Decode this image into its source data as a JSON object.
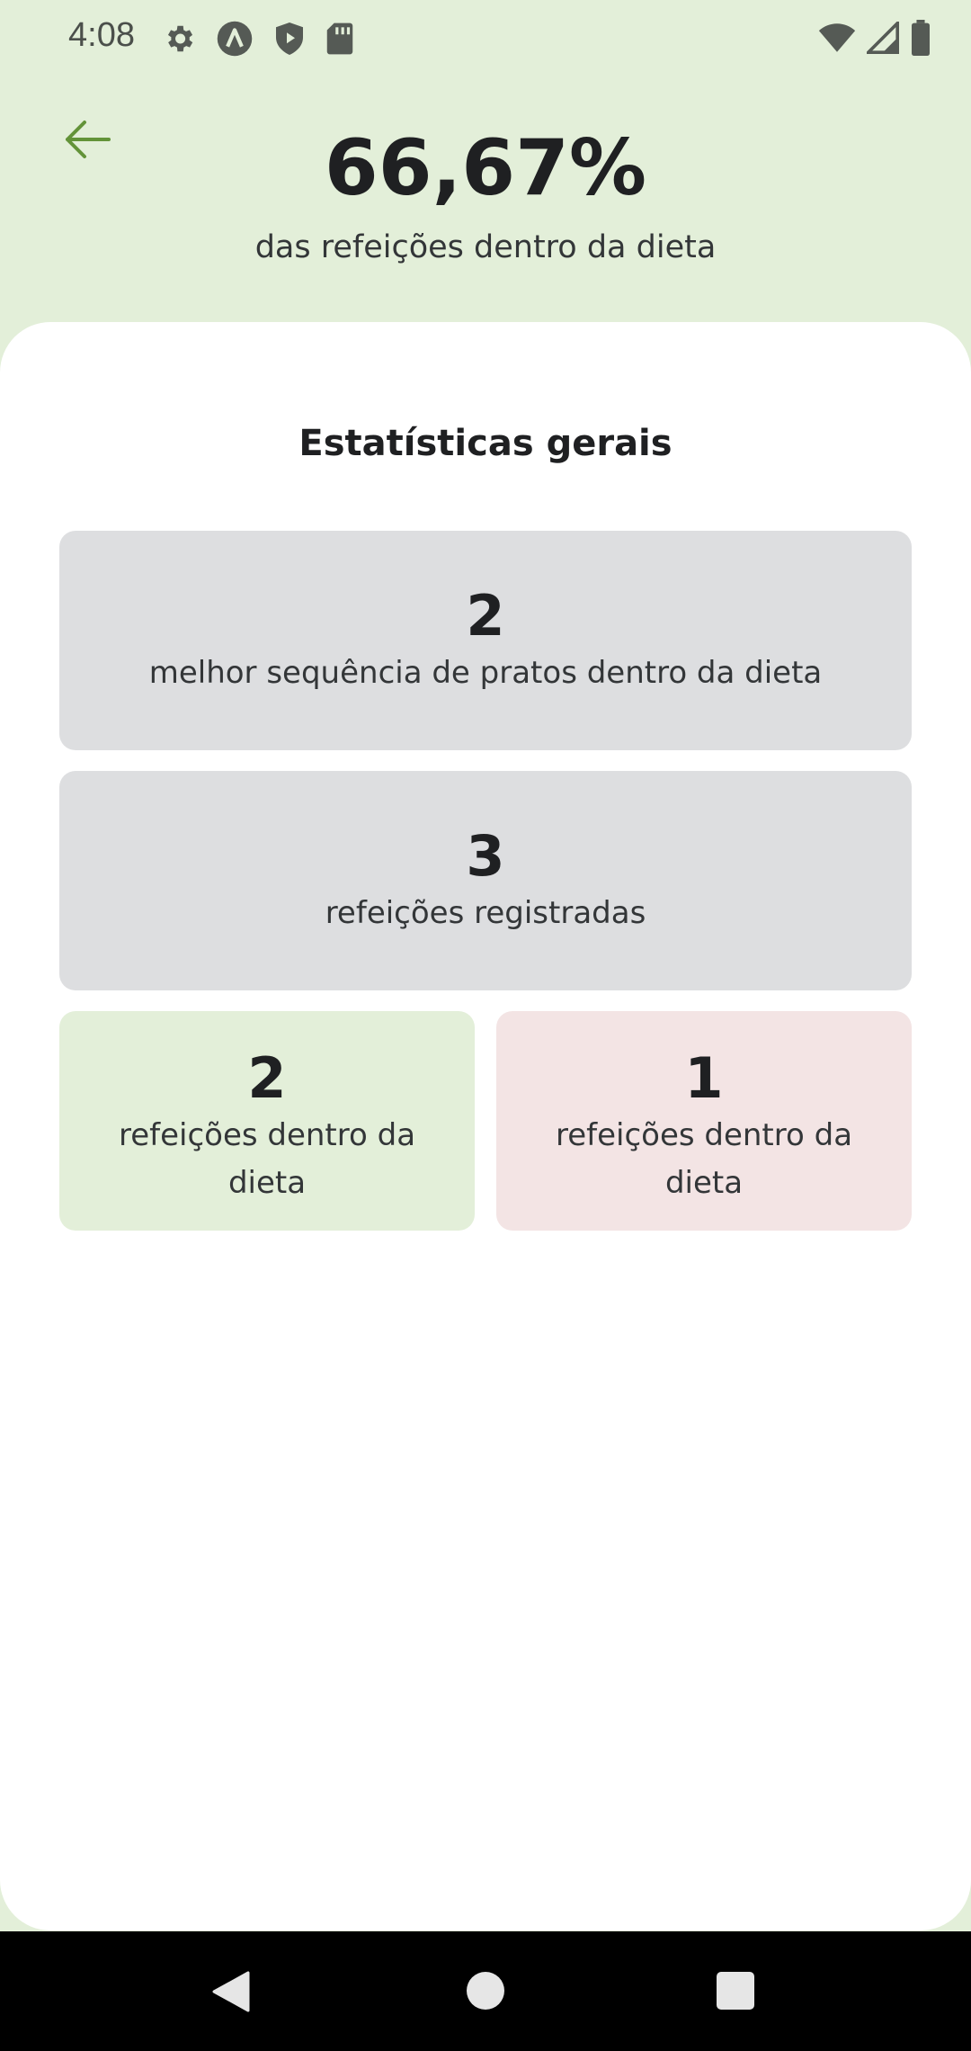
{
  "status_bar": {
    "time": "4:08",
    "left_icons": [
      "gear-icon",
      "app-a-icon",
      "play-shield-icon",
      "sd-card-icon"
    ],
    "right_icons": [
      "wifi-icon",
      "signal-icon",
      "battery-icon"
    ]
  },
  "header": {
    "percentage": "66,67%",
    "subtitle": "das refeições dentro da dieta",
    "back_icon": "arrow-left-icon",
    "background_color": "#E3EFD9",
    "accent_color": "#639339"
  },
  "stats": {
    "title": "Estatísticas gerais",
    "best_sequence": {
      "value": "2",
      "label": "melhor sequência de pratos dentro da dieta"
    },
    "registered": {
      "value": "3",
      "label": "refeições registradas"
    },
    "in_diet": {
      "value": "2",
      "label": "refeições dentro da dieta",
      "color": "#E3EFD9"
    },
    "out_diet": {
      "value": "1",
      "label": "refeições dentro da dieta",
      "color": "#F3E4E4"
    }
  },
  "nav_bar": {
    "icons": [
      "back-triangle-icon",
      "home-circle-icon",
      "recents-square-icon"
    ]
  }
}
